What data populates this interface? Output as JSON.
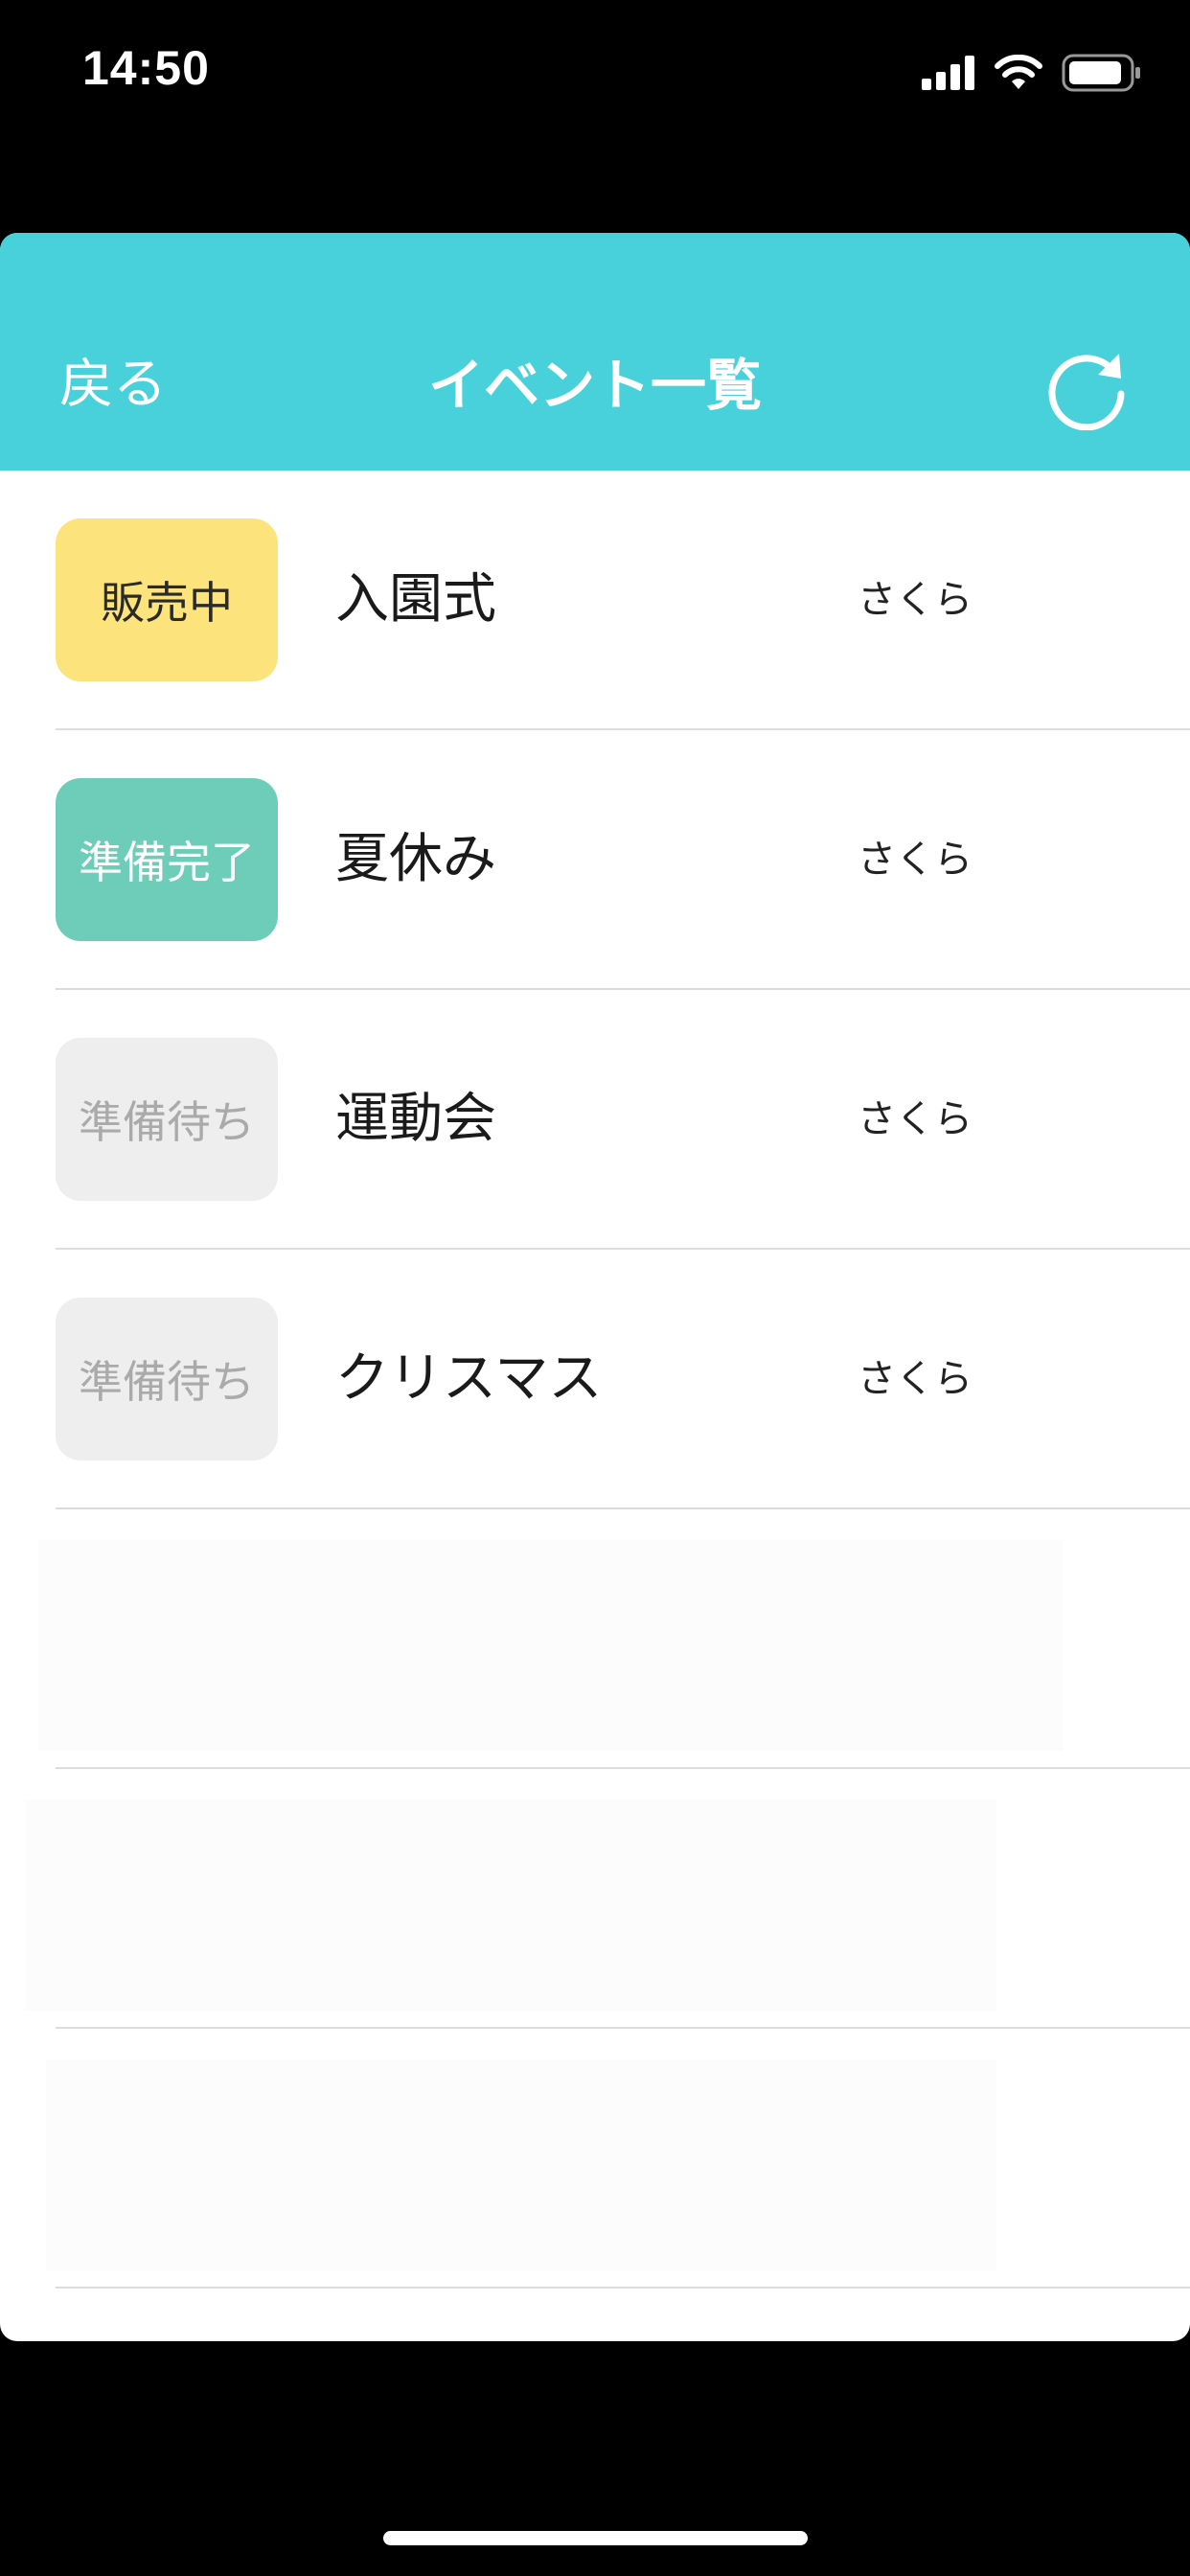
{
  "status_bar": {
    "time": "14:50",
    "icons": [
      "cellular-signal-icon",
      "wifi-icon",
      "battery-icon"
    ]
  },
  "nav": {
    "back_label": "戻る",
    "title": "イベント一覧",
    "refresh_icon": "refresh-icon"
  },
  "colors": {
    "nav_background": "#48d1db",
    "status_on_sale": "#fde37c",
    "status_ready": "#6dcdb8",
    "status_waiting": "#eeeeee"
  },
  "events": [
    {
      "status": "販売中",
      "name": "入園式",
      "owner": "さくら"
    },
    {
      "status": "準備完了",
      "name": "夏休み",
      "owner": "さくら"
    },
    {
      "status": "準備待ち",
      "name": "運動会",
      "owner": "さくら"
    },
    {
      "status": "準備待ち",
      "name": "クリスマス",
      "owner": "さくら"
    }
  ]
}
